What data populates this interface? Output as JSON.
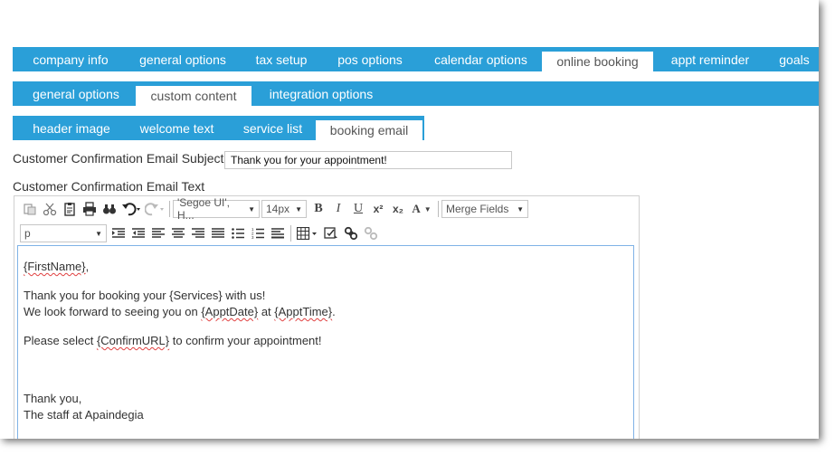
{
  "tabs_level1": [
    {
      "label": "company info",
      "active": false
    },
    {
      "label": "general options",
      "active": false
    },
    {
      "label": "tax setup",
      "active": false
    },
    {
      "label": "pos options",
      "active": false
    },
    {
      "label": "calendar options",
      "active": false
    },
    {
      "label": "online booking",
      "active": true
    },
    {
      "label": "appt reminder",
      "active": false
    },
    {
      "label": "goals",
      "active": false
    }
  ],
  "tabs_level2": [
    {
      "label": "general options",
      "active": false
    },
    {
      "label": "custom content",
      "active": true
    },
    {
      "label": "integration options",
      "active": false
    }
  ],
  "tabs_level3": [
    {
      "label": "header image",
      "active": false
    },
    {
      "label": "welcome text",
      "active": false
    },
    {
      "label": "service list",
      "active": false
    },
    {
      "label": "booking email",
      "active": true
    }
  ],
  "form": {
    "subject_label": "Customer Confirmation Email Subject",
    "subject_value": "Thank you for your appointment!",
    "body_label": "Customer Confirmation Email Text"
  },
  "toolbar": {
    "font_family": "'Segoe UI', H...",
    "font_size": "14px",
    "merge_fields": "Merge Fields",
    "paragraph": "p",
    "bold": "B",
    "italic": "I",
    "underline": "U",
    "superscript": "x²",
    "subscript": "x₂",
    "font_color": "A"
  },
  "editor": {
    "greeting_token": "{FirstName}",
    "greeting_suffix": ",",
    "line2": "Thank you for booking your {Services} with us!",
    "line3_prefix": "We look forward to seeing you on ",
    "line3_token1": "{ApptDate}",
    "line3_mid": " at ",
    "line3_token2": "{ApptTime}",
    "line3_suffix": ".",
    "line4_prefix": "Please select ",
    "line4_token": "{ConfirmURL}",
    "line4_suffix": " to confirm your appointment!",
    "sign1": "Thank you,",
    "sign2": "The staff at Apaindegia"
  },
  "colors": {
    "tab_bar": "#2a9fd8",
    "editor_border": "#7fb2e6"
  }
}
